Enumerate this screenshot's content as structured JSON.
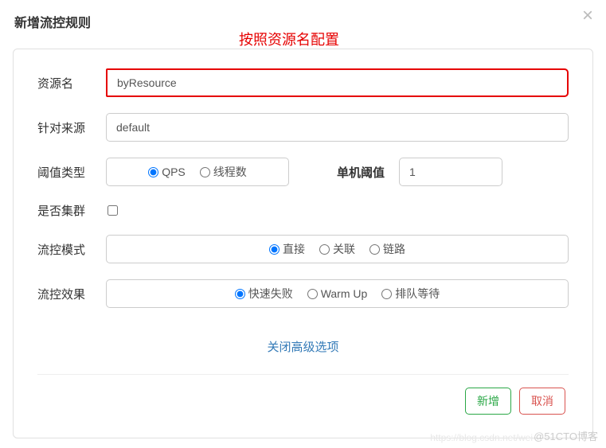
{
  "header": {
    "title": "新增流控规则"
  },
  "annotation": "按照资源名配置",
  "form": {
    "resource": {
      "label": "资源名",
      "value": "byResource"
    },
    "source": {
      "label": "针对来源",
      "value": "default"
    },
    "thresholdType": {
      "label": "阈值类型",
      "options": {
        "qps": "QPS",
        "threads": "线程数"
      }
    },
    "threshold": {
      "label": "单机阈值",
      "value": "1"
    },
    "cluster": {
      "label": "是否集群"
    },
    "mode": {
      "label": "流控模式",
      "options": {
        "direct": "直接",
        "relate": "关联",
        "chain": "链路"
      }
    },
    "effect": {
      "label": "流控效果",
      "options": {
        "fail": "快速失败",
        "warmup": "Warm Up",
        "queue": "排队等待"
      }
    }
  },
  "collapse": "关闭高级选项",
  "footer": {
    "ok": "新增",
    "cancel": "取消"
  },
  "watermark": "@51CTO博客",
  "watermark2": "https://blog.csdn.net/wei"
}
